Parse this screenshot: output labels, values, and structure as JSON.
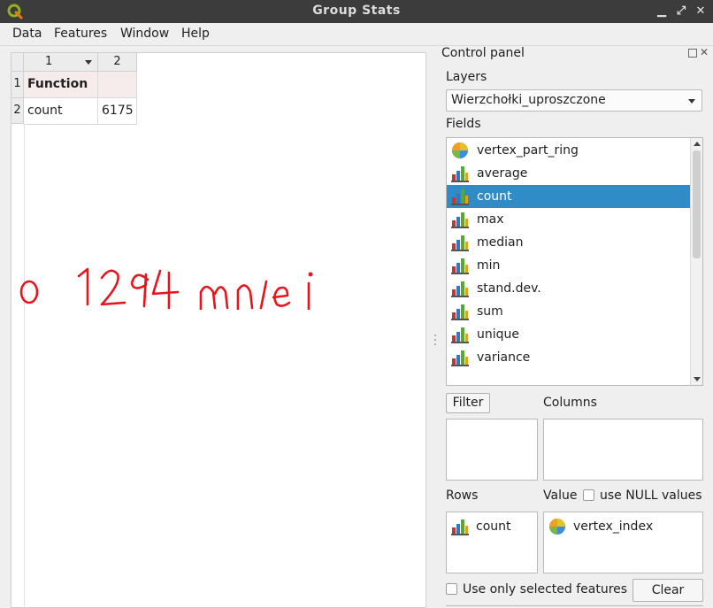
{
  "window": {
    "title": "Group Stats"
  },
  "titlebar": {
    "minimize_glyph": "▁",
    "maximize_glyph": "⤢",
    "close_glyph": "✕"
  },
  "menu": {
    "data": "Data",
    "features": "Features",
    "window": "Window",
    "help": "Help"
  },
  "table": {
    "column_headers": [
      "1",
      "2"
    ],
    "row_headers": [
      "1",
      "2"
    ],
    "rows": [
      [
        "Function",
        ""
      ],
      [
        "count",
        "6175"
      ]
    ]
  },
  "annotation": {
    "handwritten_text": "o 1294 mniej",
    "color": "#e8141c"
  },
  "panel": {
    "title": "Control panel",
    "layers_label": "Layers",
    "layer_selected": "Wierzchołki_uproszczone",
    "fields_label": "Fields",
    "fields": [
      {
        "label": "vertex_part_ring",
        "icon": "field-icon"
      },
      {
        "label": "average",
        "icon": "stat-bar-icon"
      },
      {
        "label": "count",
        "icon": "stat-bar-icon",
        "selected": true
      },
      {
        "label": "max",
        "icon": "stat-bar-icon"
      },
      {
        "label": "median",
        "icon": "stat-bar-icon"
      },
      {
        "label": "min",
        "icon": "stat-bar-icon"
      },
      {
        "label": "stand.dev.",
        "icon": "stat-bar-icon"
      },
      {
        "label": "sum",
        "icon": "stat-bar-icon"
      },
      {
        "label": "unique",
        "icon": "stat-bar-icon"
      },
      {
        "label": "variance",
        "icon": "stat-bar-icon"
      }
    ],
    "filter_button": "Filter",
    "columns_label": "Columns",
    "rows_label": "Rows",
    "value_label": "Value",
    "use_null_label": "use NULL values",
    "rows_items": [
      {
        "label": "count",
        "icon": "stat-bar-icon"
      }
    ],
    "value_items": [
      {
        "label": "vertex_index",
        "icon": "field-icon"
      }
    ],
    "use_selected_label": "Use only selected features",
    "clear_button": "Clear"
  },
  "colors": {
    "selection": "#308cc6",
    "titlebar": "#3c3c3c",
    "qgis_green": "#93b023"
  }
}
